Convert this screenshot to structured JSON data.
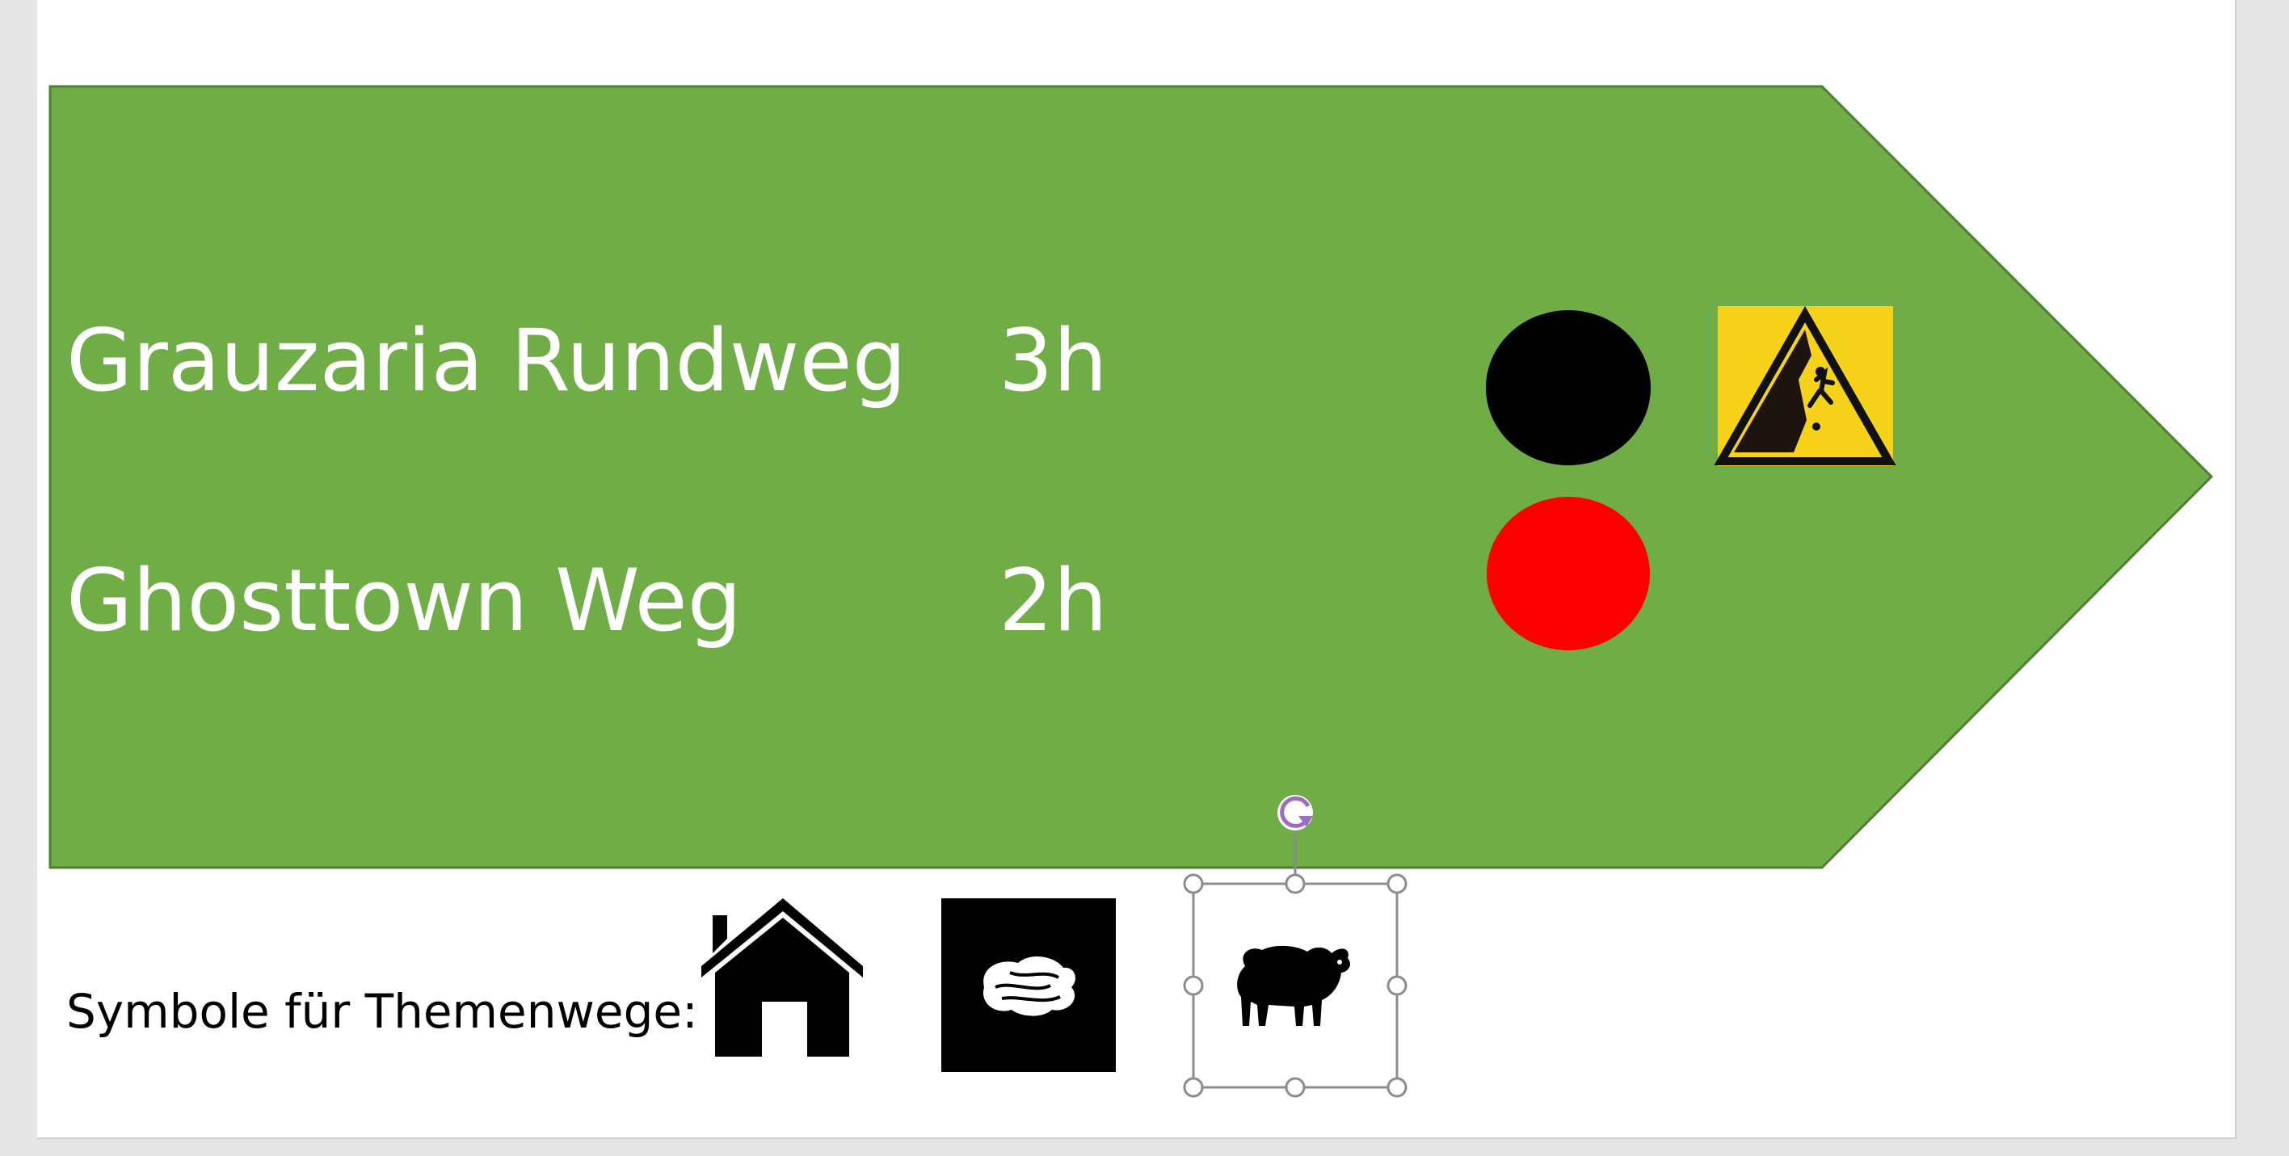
{
  "sign": {
    "fill_color": "#70ad47",
    "border_color": "#507e32",
    "routes": [
      {
        "name": "Grauzaria Rundweg",
        "duration": "3h",
        "difficulty_color": "#000000",
        "warning": "falling-rock-warning-icon"
      },
      {
        "name": "Ghosttown Weg",
        "duration": "2h",
        "difficulty_color": "#ff0000"
      }
    ]
  },
  "legend": {
    "label": "Symbole für Themenwege:",
    "symbols": [
      "house-icon",
      "stone-icon",
      "sheep-icon"
    ]
  },
  "selection": {
    "handle_color": "#8c8c8c",
    "rotate_color": "#9e6cc7"
  }
}
